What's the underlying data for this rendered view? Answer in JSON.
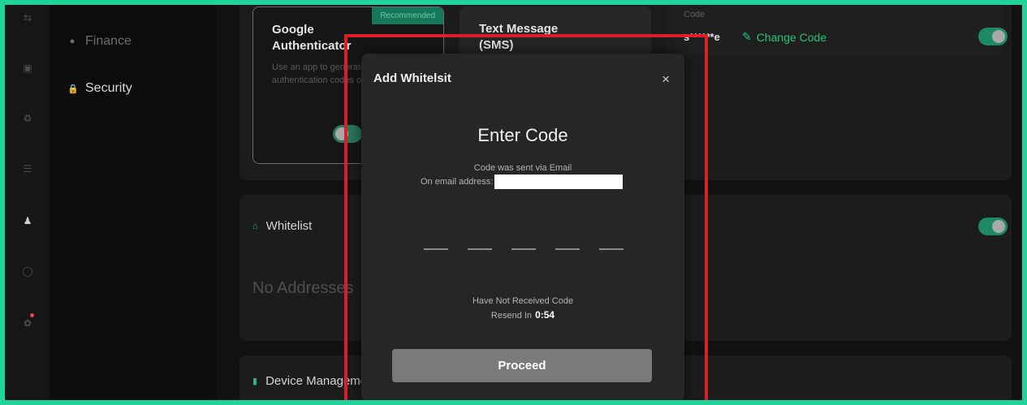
{
  "sidebar": {
    "items": [
      {
        "label": "Finance",
        "icon": "info-circle-icon"
      },
      {
        "label": "Security",
        "icon": "lock-icon"
      }
    ]
  },
  "icon_rail": [
    "exchange-icon",
    "wallet-icon",
    "recycle-icon",
    "list-icon",
    "user-icon",
    "chat-icon",
    "notification-icon"
  ],
  "two_factor": {
    "google": {
      "title": "Google Authenticator",
      "badge": "Recommended",
      "description": "Use an app to generate sensitive authentication codes on your phone"
    },
    "sms": {
      "title": "Text Message (SMS)"
    },
    "code": {
      "label": "Code",
      "value": "s******e",
      "change_label": "Change Code"
    }
  },
  "whitelist": {
    "title": "Whitelist",
    "empty": "No Addresses"
  },
  "device": {
    "title": "Device Management"
  },
  "modal": {
    "title": "Add Whitelsit",
    "close": "×",
    "heading": "Enter Code",
    "sent_via": "Code was sent via Email",
    "email_label": "On email address:",
    "not_received": "Have Not Received Code",
    "resend_label": "Resend In",
    "resend_timer": "0:54",
    "proceed": "Proceed"
  },
  "colors": {
    "accent": "#1fd39a",
    "highlight": "#e11d2a",
    "link": "#22c57e"
  }
}
